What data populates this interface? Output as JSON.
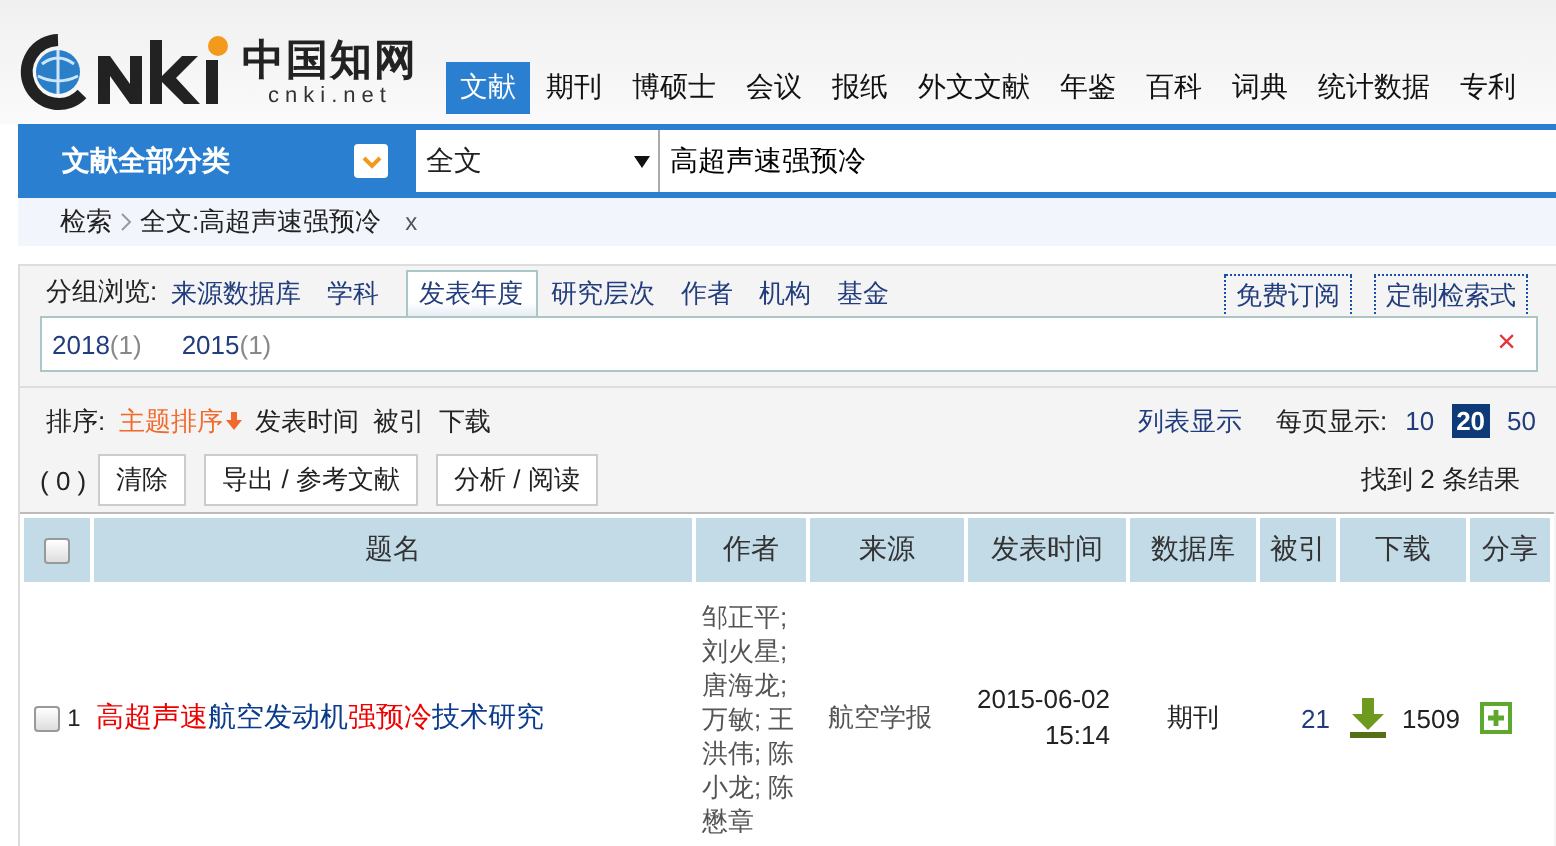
{
  "logo": {
    "chars": "中国知网",
    "domain": "cnki.net"
  },
  "nav_tabs": [
    {
      "label": "文献",
      "selected": true
    },
    {
      "label": "期刊",
      "selected": false
    },
    {
      "label": "博硕士",
      "selected": false
    },
    {
      "label": "会议",
      "selected": false
    },
    {
      "label": "报纸",
      "selected": false
    },
    {
      "label": "外文文献",
      "selected": false
    },
    {
      "label": "年鉴",
      "selected": false
    },
    {
      "label": "百科",
      "selected": false
    },
    {
      "label": "词典",
      "selected": false
    },
    {
      "label": "统计数据",
      "selected": false
    },
    {
      "label": "专利",
      "selected": false
    }
  ],
  "search": {
    "category": "文献全部分类",
    "field": "全文",
    "value": "高超声速强预冷"
  },
  "breadcrumb": {
    "root": "检索",
    "current": "全文:高超声速强预冷",
    "remove": "x"
  },
  "group_browse": {
    "label": "分组浏览:",
    "tabs": [
      {
        "label": "来源数据库",
        "selected": false
      },
      {
        "label": "学科",
        "selected": false
      },
      {
        "label": "发表年度",
        "selected": true
      },
      {
        "label": "研究层次",
        "selected": false
      },
      {
        "label": "作者",
        "selected": false
      },
      {
        "label": "机构",
        "selected": false
      },
      {
        "label": "基金",
        "selected": false
      }
    ],
    "actions": [
      "免费订阅",
      "定制检索式"
    ],
    "values": [
      {
        "year": "2018",
        "count": "(1)"
      },
      {
        "year": "2015",
        "count": "(1)"
      }
    ],
    "close": "×"
  },
  "sort": {
    "label": "排序:",
    "options": [
      {
        "label": "主题排序",
        "selected": true
      },
      {
        "label": "发表时间",
        "selected": false
      },
      {
        "label": "被引",
        "selected": false
      },
      {
        "label": "下载",
        "selected": false
      }
    ],
    "view": "列表显示",
    "per_page_label": "每页显示:",
    "per_page": [
      {
        "label": "10",
        "selected": false
      },
      {
        "label": "20",
        "selected": true
      },
      {
        "label": "50",
        "selected": false
      }
    ]
  },
  "toolbar": {
    "selected_count": "( 0 )",
    "buttons": [
      "清除",
      "导出 / 参考文献",
      "分析 / 阅读"
    ],
    "result": "找到 2 条结果"
  },
  "table": {
    "columns": [
      "题名",
      "作者",
      "来源",
      "发表时间",
      "数据库",
      "被引",
      "下载",
      "分享"
    ],
    "all_checked": false,
    "rows": [
      {
        "checked": false,
        "index": "1",
        "title": [
          {
            "text": "高超声速",
            "highlight": true
          },
          {
            "text": "航空发动机",
            "highlight": false
          },
          {
            "text": "强预冷",
            "highlight": true
          },
          {
            "text": "技术研究",
            "highlight": false
          }
        ],
        "authors": "邹正平; 刘火星; 唐海龙; 万敏; 王洪伟; 陈小龙; 陈懋章",
        "source": "航空学报",
        "date": "2015-06-02 15:14",
        "database": "期刊",
        "cited": "21",
        "downloads": "1509"
      }
    ]
  }
}
